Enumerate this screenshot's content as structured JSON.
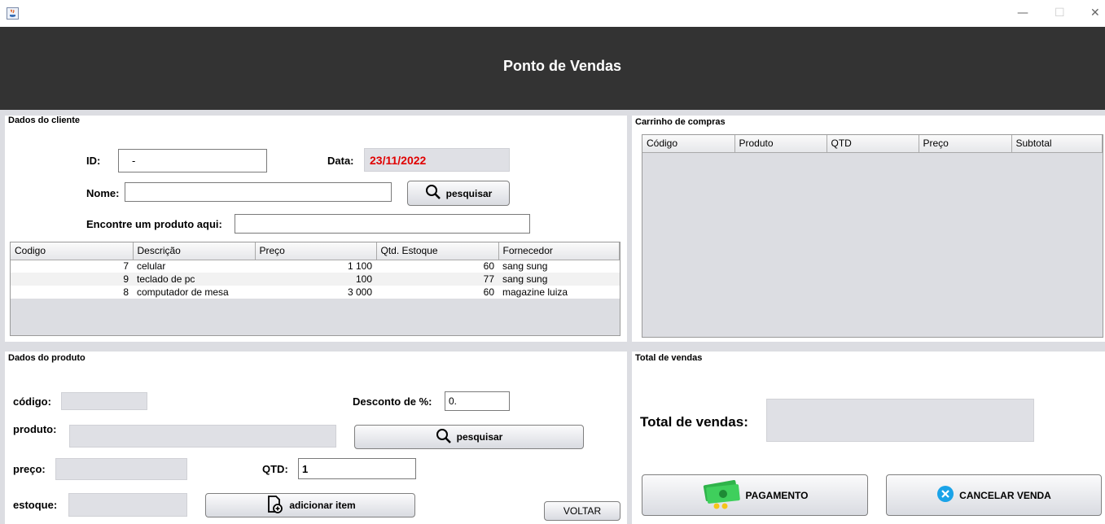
{
  "window": {
    "minimize": "—",
    "maximize": "☐",
    "close": "✕"
  },
  "header": {
    "title": "Ponto de Vendas"
  },
  "client": {
    "section_title": "Dados do cliente",
    "id_label": "ID:",
    "id_value": "-",
    "date_label": "Data:",
    "date_value": "23/11/2022",
    "name_label": "Nome:",
    "name_value": "",
    "search_button": "pesquisar",
    "find_product_label": "Encontre um produto aqui:",
    "find_product_value": "",
    "table": {
      "columns": [
        "Codigo",
        "Descrição",
        "Preço",
        "Qtd. Estoque",
        "Fornecedor"
      ],
      "rows": [
        [
          "7",
          "celular",
          "1 100",
          "60",
          "sang sung"
        ],
        [
          "9",
          "teclado de pc",
          "100",
          "77",
          "sang sung"
        ],
        [
          "8",
          "computador de mesa",
          "3 000",
          "60",
          "magazine luiza"
        ]
      ]
    }
  },
  "cart": {
    "section_title": "Carrinho de compras",
    "columns": [
      "Código",
      "Produto",
      "QTD",
      "Preço",
      "Subtotal"
    ]
  },
  "product": {
    "section_title": "Dados do produto",
    "code_label": "código:",
    "product_label": "produto:",
    "price_label": "preço:",
    "stock_label": "estoque:",
    "discount_label": "Desconto de %:",
    "discount_value": "0.",
    "qty_label": "QTD:",
    "qty_value": "1",
    "search_button": "pesquisar",
    "add_button": "adicionar item",
    "back_button": "VOLTAR"
  },
  "totals": {
    "section_title": "Total de vendas",
    "total_label": "Total de vendas:",
    "pay_button": "PAGAMENTO",
    "cancel_button": "CANCELAR VENDA"
  },
  "colors": {
    "header_bg": "#333333",
    "date_text": "#e00000",
    "cancel_icon": "#1aa3e8",
    "money_icon": "#2fb34a"
  }
}
